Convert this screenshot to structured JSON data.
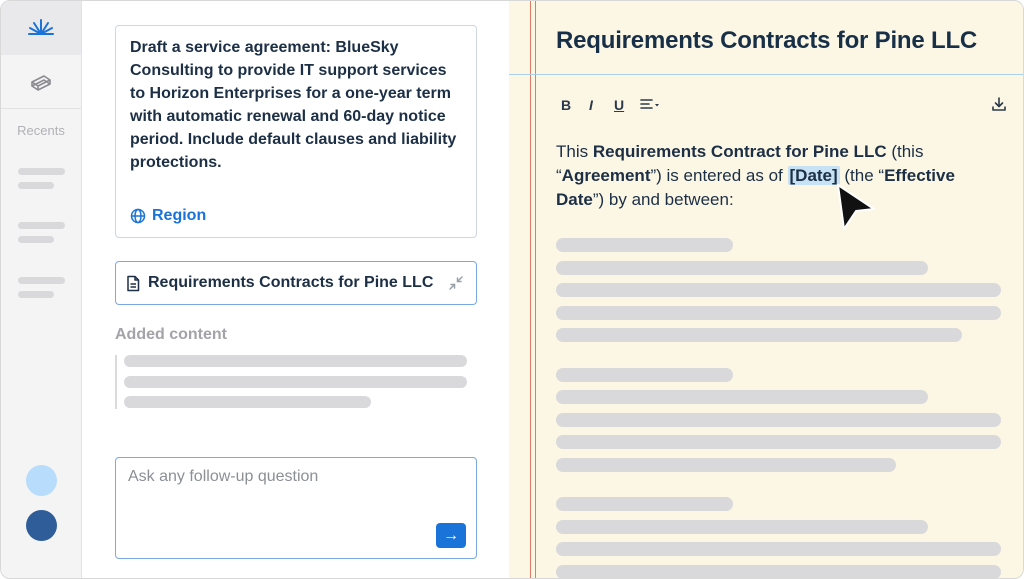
{
  "sidebar": {
    "recents_label": "Recents"
  },
  "chat": {
    "prompt": "Draft a service agreement: BlueSky Consulting to provide IT support services to Horizon Enterprises for a one-year term with automatic renewal and 60-day notice period. Include default clauses and liability protections.",
    "region_label": "Region",
    "attached_doc": "Requirements Contracts for Pine LLC",
    "added_content_label": "Added content",
    "followup_placeholder": "Ask any follow-up question"
  },
  "document": {
    "title": "Requirements Contracts for Pine LLC",
    "toolbar": {
      "bold": "B",
      "italic": "I",
      "underline": "U"
    },
    "intro": {
      "t1": "This ",
      "b1": "Requirements Contract for Pine LLC",
      "t2": " (this “",
      "b2": "Agreement",
      "t3": "”) is entered as of ",
      "date": "[Date]",
      "t4": " (the “",
      "b3": "Effective Date",
      "t5": "”) by and between:"
    }
  },
  "colors": {
    "accent": "#1a73d9",
    "doc_background": "#fcf6e4",
    "margin_line": "#e07c66",
    "avatar_light": "#b8dcfb",
    "avatar_dark": "#2f5d9a"
  }
}
